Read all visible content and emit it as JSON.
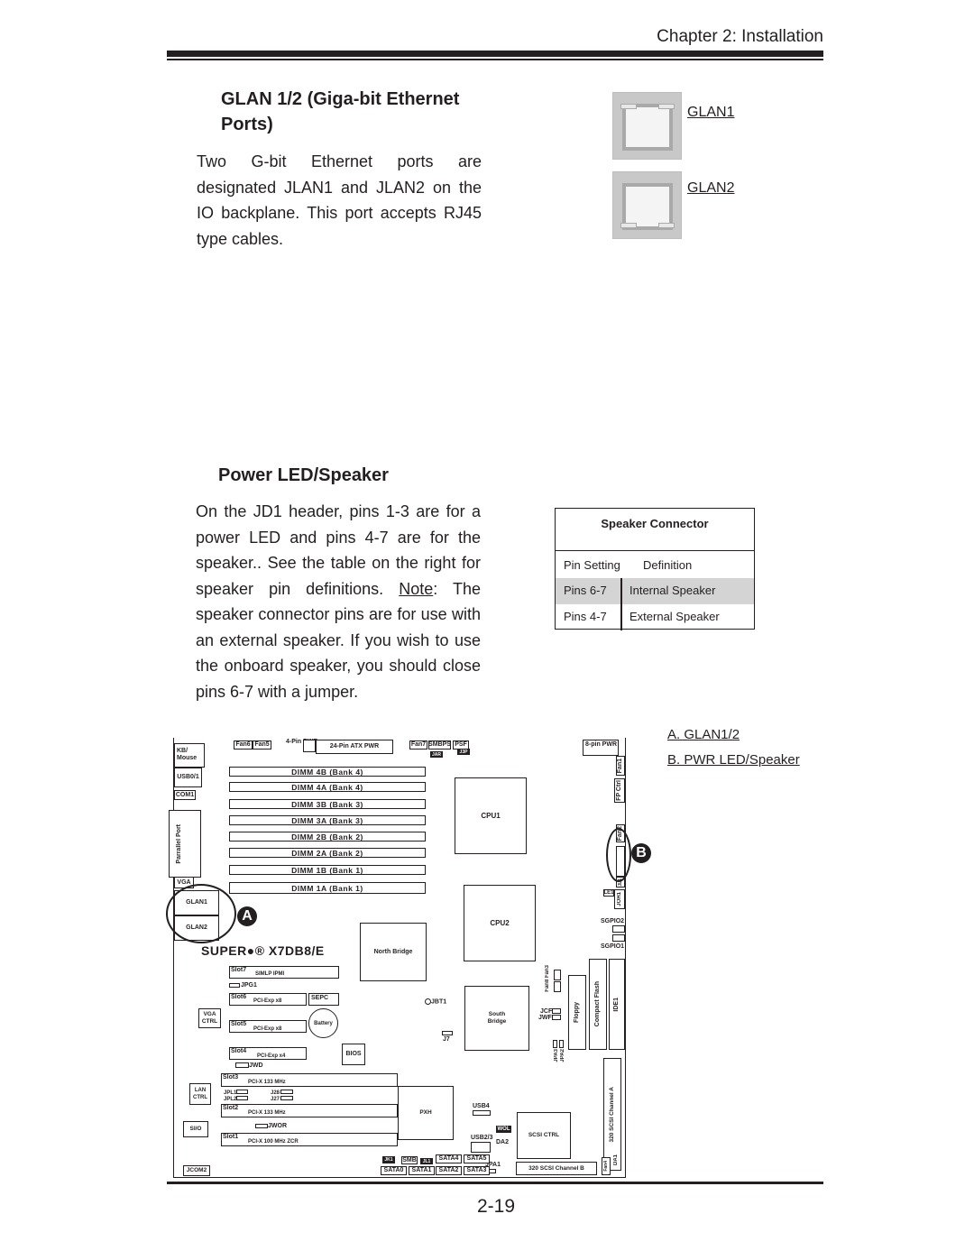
{
  "header": {
    "chapter": "Chapter 2: Installation"
  },
  "glan_section": {
    "heading_line1": "GLAN 1/2 (Giga-bit Ethernet",
    "heading_line2": "Ports)",
    "body": "Two G-bit Ethernet ports are  designated JLAN1 and JLAN2 on the IO backplane.  This port accepts RJ45 type cables.",
    "ports": [
      {
        "label": "GLAN1",
        "icon": "rj45-port-icon"
      },
      {
        "label": "GLAN2",
        "icon": "rj45-port-icon"
      }
    ]
  },
  "power_section": {
    "heading": "Power LED/Speaker",
    "body_before_note": "On the JD1 header, pins 1-3  are for a power LED and pins 4-7 are for the speaker..  See the table on the right for speaker pin definitions. ",
    "note_label": "Note",
    "body_after_note": ": The speaker connector pins are for use with an external speaker.  If you wish to use the onboard speaker, you should close pins 6-7 with a jumper."
  },
  "speaker_table": {
    "title": "Speaker Connector",
    "headers": [
      "Pin Setting",
      "Definition"
    ],
    "rows": [
      {
        "pins": "Pins 6-7",
        "definition": "Internal Speaker",
        "shaded": true
      },
      {
        "pins": "Pins 4-7",
        "definition": "External Speaker",
        "shaded": false
      }
    ]
  },
  "diagram": {
    "brand": "SUPER●® X7DB8/E",
    "callouts": {
      "a": "A",
      "b": "B"
    },
    "legend": [
      "A. GLAN1/2",
      "B. PWR LED/Speaker"
    ],
    "left_io": [
      "KB/ Mouse",
      "USB0/1",
      "COM1",
      "Parrallel Port",
      "VGA",
      "GLAN1",
      "GLAN2"
    ],
    "top": {
      "fan6": "Fan6",
      "fan5": "Fan5",
      "pwr4": "4-Pin PWR",
      "atx": "24-Pin ATX PWR",
      "fan7": "Fan7",
      "smbps": "SMBPS",
      "psf": "PSF",
      "jar": "JAR",
      "j3p": "J3P",
      "pwr8": "8-pin PWR"
    },
    "dimms": [
      "DIMM 4B (Bank 4)",
      "DIMM 4A (Bank 4)",
      "DIMM 3B (Bank 3)",
      "DIMM 3A (Bank 3)",
      "DIMM 2B (Bank 2)",
      "DIMM 2A (Bank 2)",
      "DIMM 1B (Bank 1)",
      "DIMM 1A (Bank 1)"
    ],
    "cpu1": "CPU1",
    "cpu2": "CPU2",
    "right_edge": {
      "fan1": "Fan1",
      "fpctrl": "FP Ctrl",
      "fan2": "Fan2",
      "jd1": "JD1",
      "jl1": "JL1",
      "le1": "LE1",
      "joh1": "JOH1",
      "sgpio2": "SGPIO2",
      "sgpio1": "SGPIO1"
    },
    "north_bridge": "North Bridge",
    "slots": [
      {
        "slot": "Slot7",
        "label": "SIMLP IPMI"
      },
      {
        "slot": "Slot6",
        "label": "PCI-Exp  x8"
      },
      {
        "slot": "Slot5",
        "label": "PCI-Exp  x8"
      },
      {
        "slot": "Slot4",
        "label": "PCI-Exp  x4"
      },
      {
        "slot": "Slot3",
        "label": "PCI-X 133 MHz"
      },
      {
        "slot": "Slot2",
        "label": "PCI-X 133 MHz"
      },
      {
        "slot": "Slot1",
        "label": "PCI-X 100 MHz  ZCR"
      }
    ],
    "misc": {
      "jpg1": "JPG1",
      "sepc": "SEPC",
      "battery": "Battery",
      "bios": "BIOS",
      "jwd": "JWD",
      "vga_ctrl": "VGA CTRL",
      "lan_ctrl": "LAN CTRL",
      "sio": "SI/O",
      "jcom2": "JCOM2",
      "jpl1": "JPL1",
      "jpl2": "JPL2",
      "j28": "J28",
      "j27": "J27",
      "jwor": "JWOR",
      "jbt1": "JBT1",
      "j7": "J7",
      "south_bridge": "South Bridge",
      "pxh": "PXH",
      "jcf1": "JCF1",
      "jwf1": "JWF1",
      "fan8": "Fan8",
      "fan3": "Fan3",
      "jpa3": "JPA3",
      "jpa2": "JPA2",
      "floppy": "Floppy",
      "compact_flash": "Compact Flash",
      "ide1": "IDE1",
      "scsi_a": "320 SCSI  Channel  A",
      "scsi_b": "320 SCSI  Channel  B",
      "scsi_ctrl": "SCSI CTRL",
      "usb4": "USB4",
      "usb23": "USB2/3",
      "wol": "WOL",
      "da2": "DA2",
      "da1": "DA1",
      "jpa1": "JPA1",
      "fan4": "Fan4",
      "jk1": "JK1",
      "smb": "SMB",
      "jl1b": "JL1",
      "sata": [
        "SATA0",
        "SATA1",
        "SATA2",
        "SATA3",
        "SATA4",
        "SATA5"
      ]
    }
  },
  "footer": {
    "page_number": "2-19"
  }
}
